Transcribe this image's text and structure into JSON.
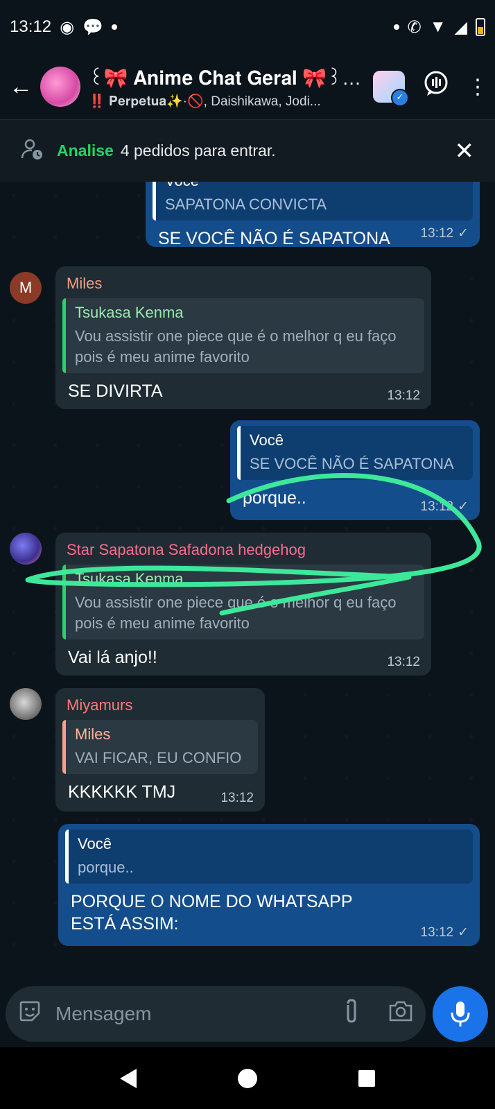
{
  "status_bar": {
    "time": "13:12"
  },
  "header": {
    "title": "꒰🎀 𝐀𝐧𝐢𝐦𝐞 𝐂𝐡𝐚𝐭 𝐆𝐞𝐫𝐚𝐥 🎀꒱ ✧ Chat Ge...",
    "members": "‼️ 𝐏𝐞𝐫𝐩𝐞𝐭𝐮𝐚✨·🚫, Daishikawa, Jodi..."
  },
  "request_bar": {
    "highlight": "Analise",
    "text": "4 pedidos para entrar."
  },
  "messages": [
    {
      "quote_name": "Você",
      "quote_text": "SAPATONA CONVICTA",
      "text": "SE VOCÊ NÃO É SAPATONA",
      "time": "13:12"
    },
    {
      "sender": "Miles",
      "avatar_letter": "M",
      "quote_name": "Tsukasa Kenma",
      "quote_text": "Vou assistir one piece que é o melhor q eu faço pois é meu anime favorito",
      "text": "SE DIVIRTA",
      "time": "13:12"
    },
    {
      "quote_name": "Você",
      "quote_text": "SE VOCÊ NÃO É SAPATONA",
      "text": "porque..",
      "time": "13:12"
    },
    {
      "sender": "Star Sapatona Safadona hedgehog",
      "quote_name": "Tsukasa Kenma",
      "quote_text": "Vou assistir one piece que é o melhor q eu faço pois é meu anime favorito",
      "text": "Vai lá anjo!!",
      "time": "13:12"
    },
    {
      "sender": "Miyamurs",
      "quote_name": "Miles",
      "quote_text": "VAI FICAR, EU CONFIO",
      "text": "KKKKKK TMJ",
      "time": "13:12"
    },
    {
      "quote_name": "Você",
      "quote_text": "porque..",
      "text": "PORQUE O NOME DO WHATSAPP ESTÁ ASSIM:",
      "time": "13:12"
    }
  ],
  "input": {
    "placeholder": "Mensagem"
  },
  "colors": {
    "sender_miles": "#f4a07f",
    "sender_star": "#ff6b8e",
    "sender_miyamurs": "#ff7a7a",
    "quote_name_green": "#25d366",
    "quote_name_salmon": "#ffb39e",
    "highlight_scribble": "#3de89a"
  }
}
